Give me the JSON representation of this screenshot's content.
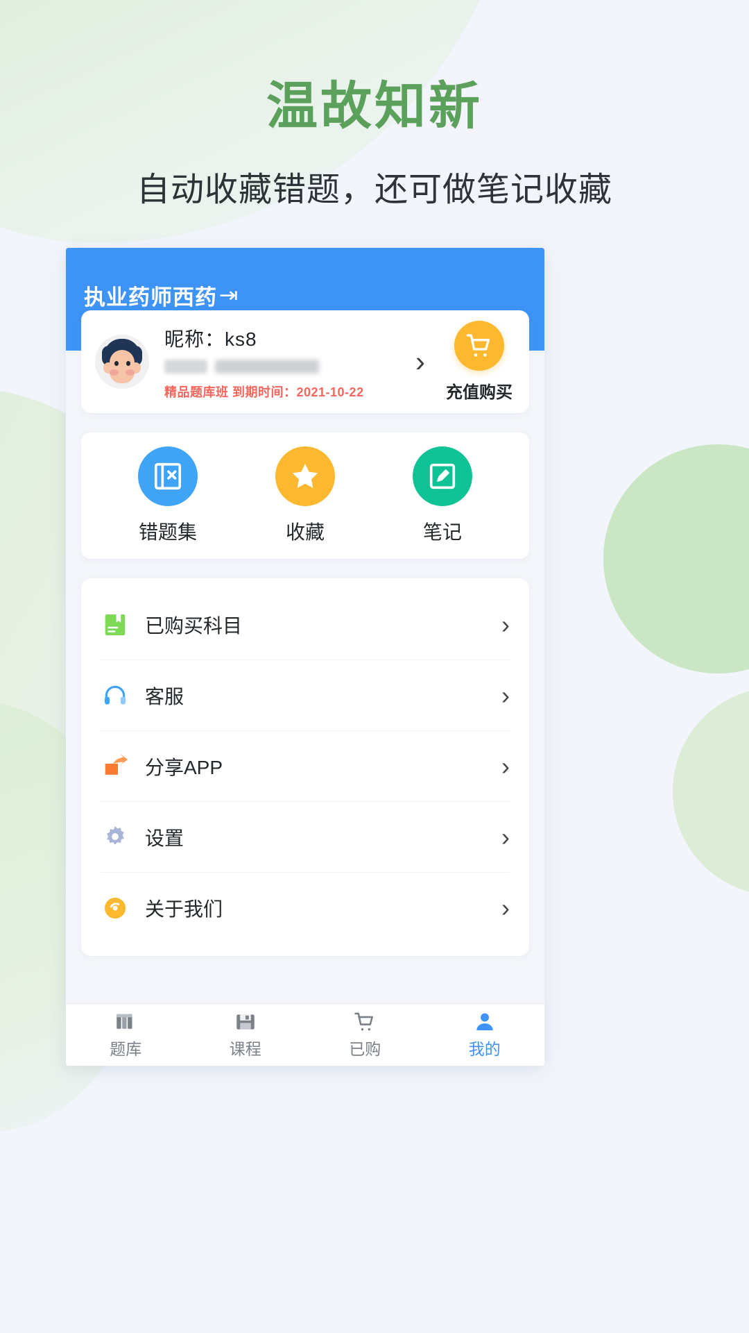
{
  "promo": {
    "headline": "温故知新",
    "subhead": "自动收藏错题，还可做笔记收藏",
    "headline_color": "#5ba05b",
    "subhead_color": "#2e3338"
  },
  "app": {
    "header": {
      "title": "执业药师西药",
      "chevron": "⇥",
      "background": "#3d94f6"
    },
    "profile": {
      "nickname": "昵称：ks8",
      "blurred_line": "",
      "expiry": "精品题库班   到期时间：2021-10-22",
      "expiry_color": "#f4665e",
      "chevron": "›",
      "recharge_label": "充值购买",
      "cart_icon": "cart-icon",
      "cart_color": "#fcb82e",
      "avatar_icon": "avatar"
    },
    "features": [
      {
        "label": "错题集",
        "icon": "wrong-question-book-icon",
        "color": "#3fa4f5"
      },
      {
        "label": "收藏",
        "icon": "star-icon",
        "color": "#fcb82e"
      },
      {
        "label": "笔记",
        "icon": "note-pencil-icon",
        "color": "#10c396"
      }
    ],
    "menu": [
      {
        "label": "已购买科目",
        "icon": "purchased-subject-icon",
        "color": "#7ed957",
        "chevron": "›"
      },
      {
        "label": "客服",
        "icon": "headset-icon",
        "color": "#3fa4f5",
        "chevron": "›"
      },
      {
        "label": "分享APP",
        "icon": "share-icon",
        "color": "#f97b34",
        "chevron": "›"
      },
      {
        "label": "设置",
        "icon": "gear-icon",
        "color": "#a8b4d8",
        "chevron": "›"
      },
      {
        "label": "关于我们",
        "icon": "info-circle-icon",
        "color": "#fcb82e",
        "chevron": "›"
      }
    ],
    "tabs": [
      {
        "label": "题库",
        "icon": "books-icon",
        "active": false
      },
      {
        "label": "课程",
        "icon": "course-icon",
        "active": false
      },
      {
        "label": "已购",
        "icon": "cart-icon",
        "active": false
      },
      {
        "label": "我的",
        "icon": "person-icon",
        "active": true
      }
    ],
    "accent_color": "#3d94f6"
  }
}
